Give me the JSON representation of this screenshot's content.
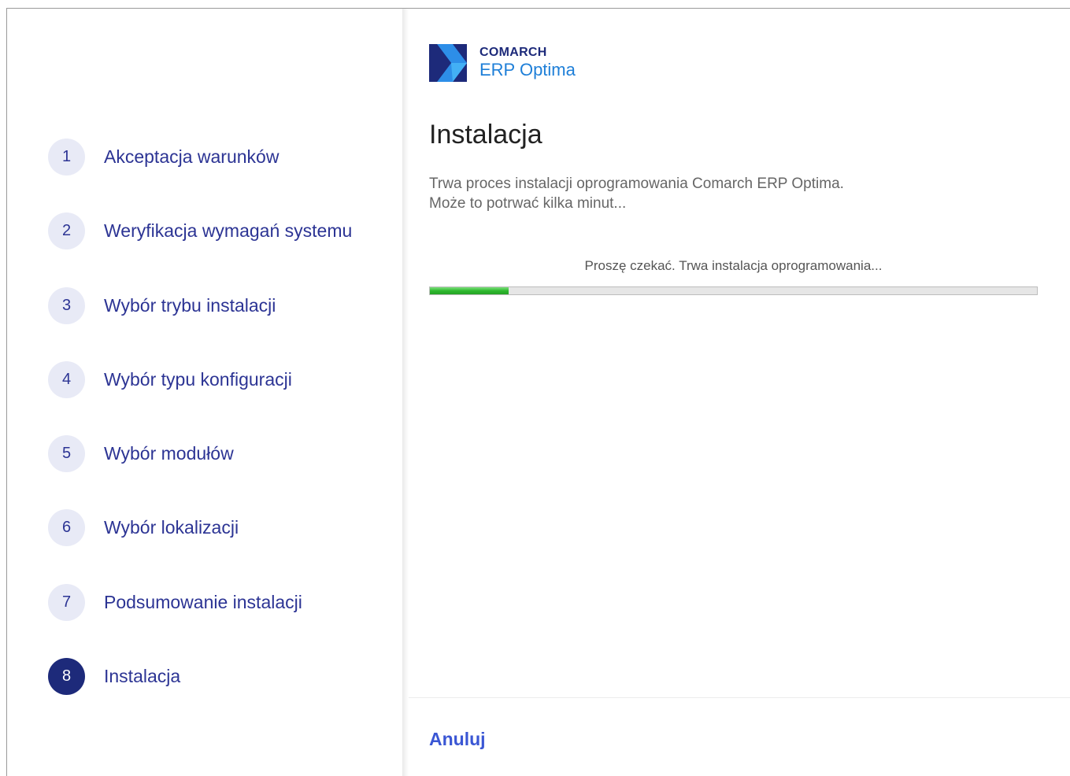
{
  "sidebar": {
    "steps": [
      {
        "number": "1",
        "label": "Akceptacja warunków"
      },
      {
        "number": "2",
        "label": "Weryfikacja wymagań systemu"
      },
      {
        "number": "3",
        "label": "Wybór trybu instalacji"
      },
      {
        "number": "4",
        "label": "Wybór typu konfiguracji"
      },
      {
        "number": "5",
        "label": "Wybór modułów"
      },
      {
        "number": "6",
        "label": "Wybór lokalizacji"
      },
      {
        "number": "7",
        "label": "Podsumowanie instalacji"
      },
      {
        "number": "8",
        "label": "Instalacja"
      }
    ],
    "active_step": 8
  },
  "logo": {
    "brand": "COMARCH",
    "product": "ERP Optima"
  },
  "main": {
    "title": "Instalacja",
    "description_line1": "Trwa proces instalacji oprogramowania Comarch ERP Optima.",
    "description_line2": "Może to potrwać kilka minut...",
    "progress_text": "Proszę czekać. Trwa instalacja oprogramowania...",
    "progress_fraction": 0.13
  },
  "footer": {
    "cancel_label": "Anuluj"
  },
  "colors": {
    "accent": "#2c3494",
    "active_step": "#1d2a7a",
    "progress": "#2eb82e",
    "link": "#3a56d4"
  }
}
